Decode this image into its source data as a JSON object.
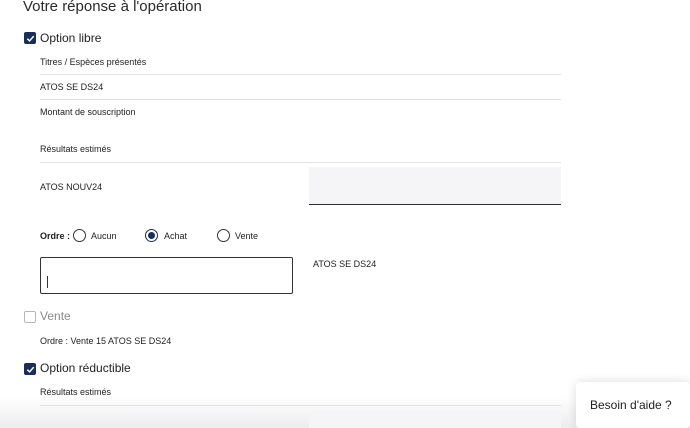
{
  "section": {
    "title": "Votre réponse à l'opération"
  },
  "option_libre": {
    "label": "Option libre",
    "checked": true,
    "titres_label": "Titres / Espèces présentés",
    "titres_value": "ATOS SE DS24",
    "montant_label": "Montant de souscription",
    "resultats_label": "Résultats estimés",
    "resultat_name": "ATOS NOUV24",
    "resultat_value": ""
  },
  "ordre": {
    "label": "Ordre :",
    "options": [
      {
        "label": "Aucun",
        "selected": false
      },
      {
        "label": "Achat",
        "selected": true
      },
      {
        "label": "Vente",
        "selected": false
      }
    ],
    "input_value": "",
    "security_label": "ATOS SE DS24"
  },
  "vente": {
    "label": "Vente",
    "checked": false,
    "ordre_text": "Ordre : Vente 15 ATOS SE DS24"
  },
  "option_reductible": {
    "label": "Option réductible",
    "checked": true,
    "resultats_label": "Résultats estimés"
  },
  "help": {
    "label": "Besoin d'aide ?"
  },
  "colors": {
    "primary": "#1a2e5a",
    "input_bg": "#f5f5f7",
    "divider": "#e2e2e2"
  },
  "icons": {
    "checkbox_checked": "check-icon"
  }
}
